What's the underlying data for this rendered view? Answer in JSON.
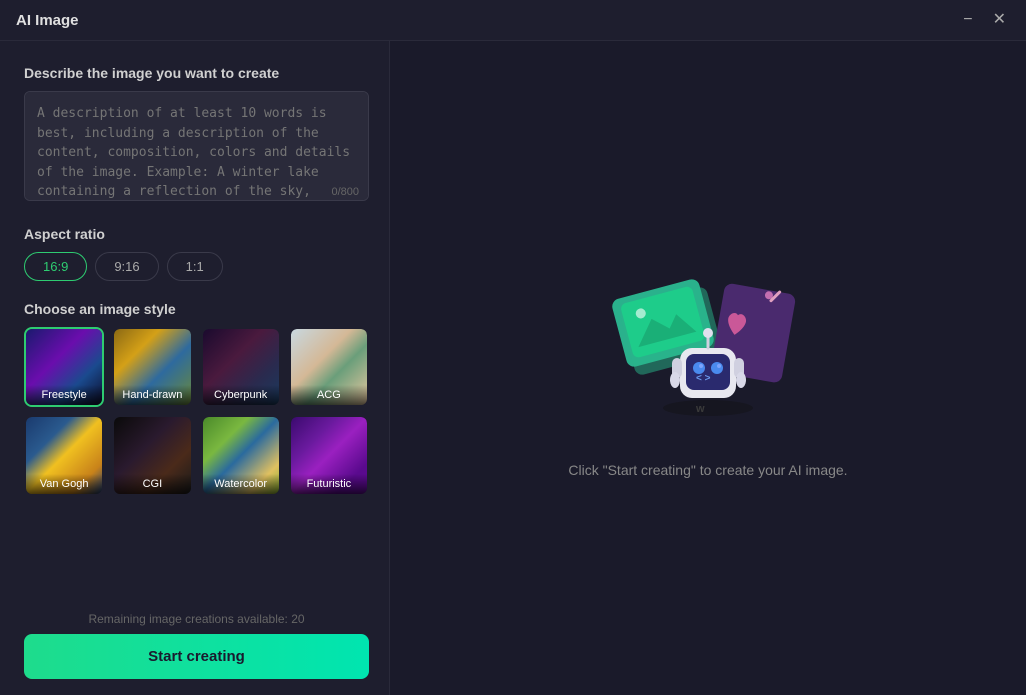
{
  "window": {
    "title": "AI Image"
  },
  "titlebar": {
    "minimize_label": "−",
    "close_label": "✕"
  },
  "left": {
    "describe_label": "Describe the image you want to create",
    "textarea_placeholder": "A description of at least 10 words is best, including a description of the content, composition, colors and details of the image. Example: A winter lake containing a reflection of the sky, covered in white",
    "char_count": "0/800",
    "aspect_label": "Aspect ratio",
    "aspect_options": [
      {
        "value": "16:9",
        "active": true
      },
      {
        "value": "9:16",
        "active": false
      },
      {
        "value": "1:1",
        "active": false
      }
    ],
    "style_label": "Choose an image style",
    "styles": [
      {
        "id": "freestyle",
        "label": "Freestyle",
        "active": true,
        "class": "style-freestyle"
      },
      {
        "id": "handdrawn",
        "label": "Hand-drawn",
        "active": false,
        "class": "style-handdrawn"
      },
      {
        "id": "cyberpunk",
        "label": "Cyberpunk",
        "active": false,
        "class": "style-cyberpunk"
      },
      {
        "id": "acg",
        "label": "ACG",
        "active": false,
        "class": "style-acg"
      },
      {
        "id": "vangogh",
        "label": "Van Gogh",
        "active": false,
        "class": "style-vangogh"
      },
      {
        "id": "cgi",
        "label": "CGI",
        "active": false,
        "class": "style-cgi"
      },
      {
        "id": "watercolor",
        "label": "Watercolor",
        "active": false,
        "class": "style-watercolor"
      },
      {
        "id": "futuristic",
        "label": "Futuristic",
        "active": false,
        "class": "style-futuristic"
      }
    ],
    "remaining_text": "Remaining image creations available: 20",
    "start_button": "Start creating"
  },
  "right": {
    "placeholder_text": "Click \"Start creating\" to create your AI image."
  }
}
